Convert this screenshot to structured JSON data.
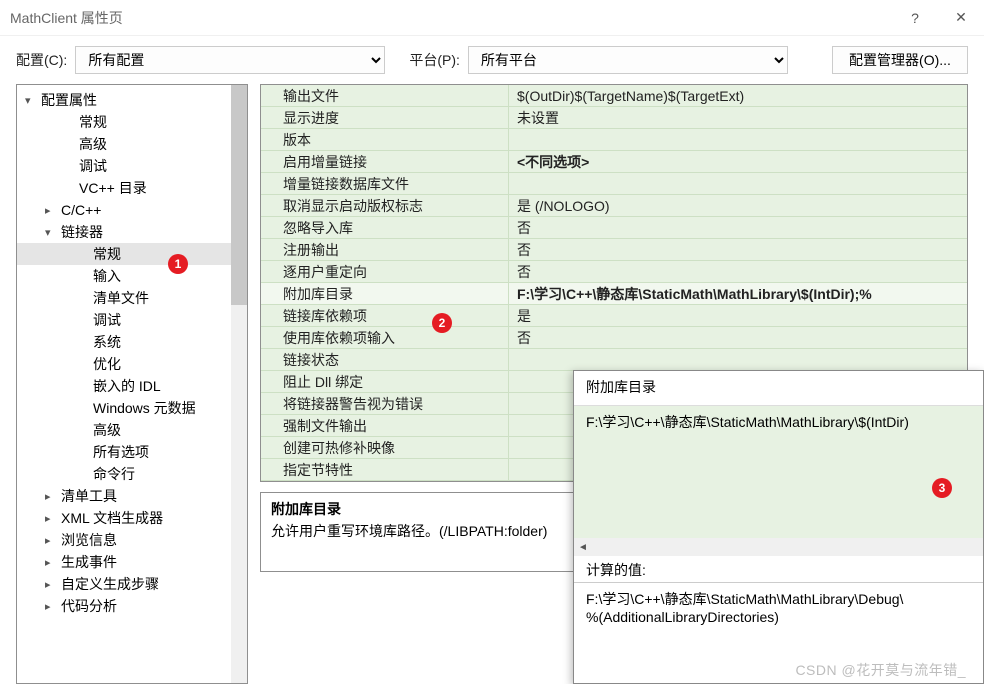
{
  "window": {
    "title": "MathClient 属性页",
    "help": "?",
    "close": "✕"
  },
  "toolbar": {
    "config_label": "配置(C):",
    "config_value": "所有配置",
    "platform_label": "平台(P):",
    "platform_value": "所有平台",
    "manager": "配置管理器(O)..."
  },
  "tree": [
    {
      "label": "配置属性",
      "indent": 8,
      "caret": "▾"
    },
    {
      "label": "常规",
      "indent": 46
    },
    {
      "label": "高级",
      "indent": 46
    },
    {
      "label": "调试",
      "indent": 46
    },
    {
      "label": "VC++ 目录",
      "indent": 46
    },
    {
      "label": "C/C++",
      "indent": 28,
      "caret": "▸"
    },
    {
      "label": "链接器",
      "indent": 28,
      "caret": "▾"
    },
    {
      "label": "常规",
      "indent": 60,
      "selected": true
    },
    {
      "label": "输入",
      "indent": 60
    },
    {
      "label": "清单文件",
      "indent": 60
    },
    {
      "label": "调试",
      "indent": 60
    },
    {
      "label": "系统",
      "indent": 60
    },
    {
      "label": "优化",
      "indent": 60
    },
    {
      "label": "嵌入的 IDL",
      "indent": 60
    },
    {
      "label": "Windows 元数据",
      "indent": 60
    },
    {
      "label": "高级",
      "indent": 60
    },
    {
      "label": "所有选项",
      "indent": 60
    },
    {
      "label": "命令行",
      "indent": 60
    },
    {
      "label": "清单工具",
      "indent": 28,
      "caret": "▸"
    },
    {
      "label": "XML 文档生成器",
      "indent": 28,
      "caret": "▸"
    },
    {
      "label": "浏览信息",
      "indent": 28,
      "caret": "▸"
    },
    {
      "label": "生成事件",
      "indent": 28,
      "caret": "▸"
    },
    {
      "label": "自定义生成步骤",
      "indent": 28,
      "caret": "▸"
    },
    {
      "label": "代码分析",
      "indent": 28,
      "caret": "▸"
    }
  ],
  "props": [
    {
      "k": "输出文件",
      "v": "$(OutDir)$(TargetName)$(TargetExt)"
    },
    {
      "k": "显示进度",
      "v": "未设置"
    },
    {
      "k": "版本",
      "v": ""
    },
    {
      "k": "启用增量链接",
      "v": "<不同选项>",
      "bold": true
    },
    {
      "k": "增量链接数据库文件",
      "v": ""
    },
    {
      "k": "取消显示启动版权标志",
      "v": "是 (/NOLOGO)"
    },
    {
      "k": "忽略导入库",
      "v": "否"
    },
    {
      "k": "注册输出",
      "v": "否"
    },
    {
      "k": "逐用户重定向",
      "v": "否"
    },
    {
      "k": "附加库目录",
      "v": "F:\\学习\\C++\\静态库\\StaticMath\\MathLibrary\\$(IntDir);%",
      "bold": true,
      "sel": true
    },
    {
      "k": "链接库依赖项",
      "v": "是"
    },
    {
      "k": "使用库依赖项输入",
      "v": "否"
    },
    {
      "k": "链接状态",
      "v": ""
    },
    {
      "k": "阻止 Dll 绑定",
      "v": ""
    },
    {
      "k": "将链接器警告视为错误",
      "v": ""
    },
    {
      "k": "强制文件输出",
      "v": ""
    },
    {
      "k": "创建可热修补映像",
      "v": ""
    },
    {
      "k": "指定节特性",
      "v": ""
    }
  ],
  "desc": {
    "title": "附加库目录",
    "body": "允许用户重写环境库路径。(/LIBPATH:folder)"
  },
  "popup": {
    "title": "附加库目录",
    "item0": "F:\\学习\\C++\\静态库\\StaticMath\\MathLibrary\\$(IntDir)",
    "calc_label": "计算的值:",
    "calc_value": "F:\\学习\\C++\\静态库\\StaticMath\\MathLibrary\\Debug\\\n%(AdditionalLibraryDirectories)"
  },
  "badges": {
    "b1": "1",
    "b2": "2",
    "b3": "3"
  },
  "watermark": "CSDN @花开莫与流年错_"
}
